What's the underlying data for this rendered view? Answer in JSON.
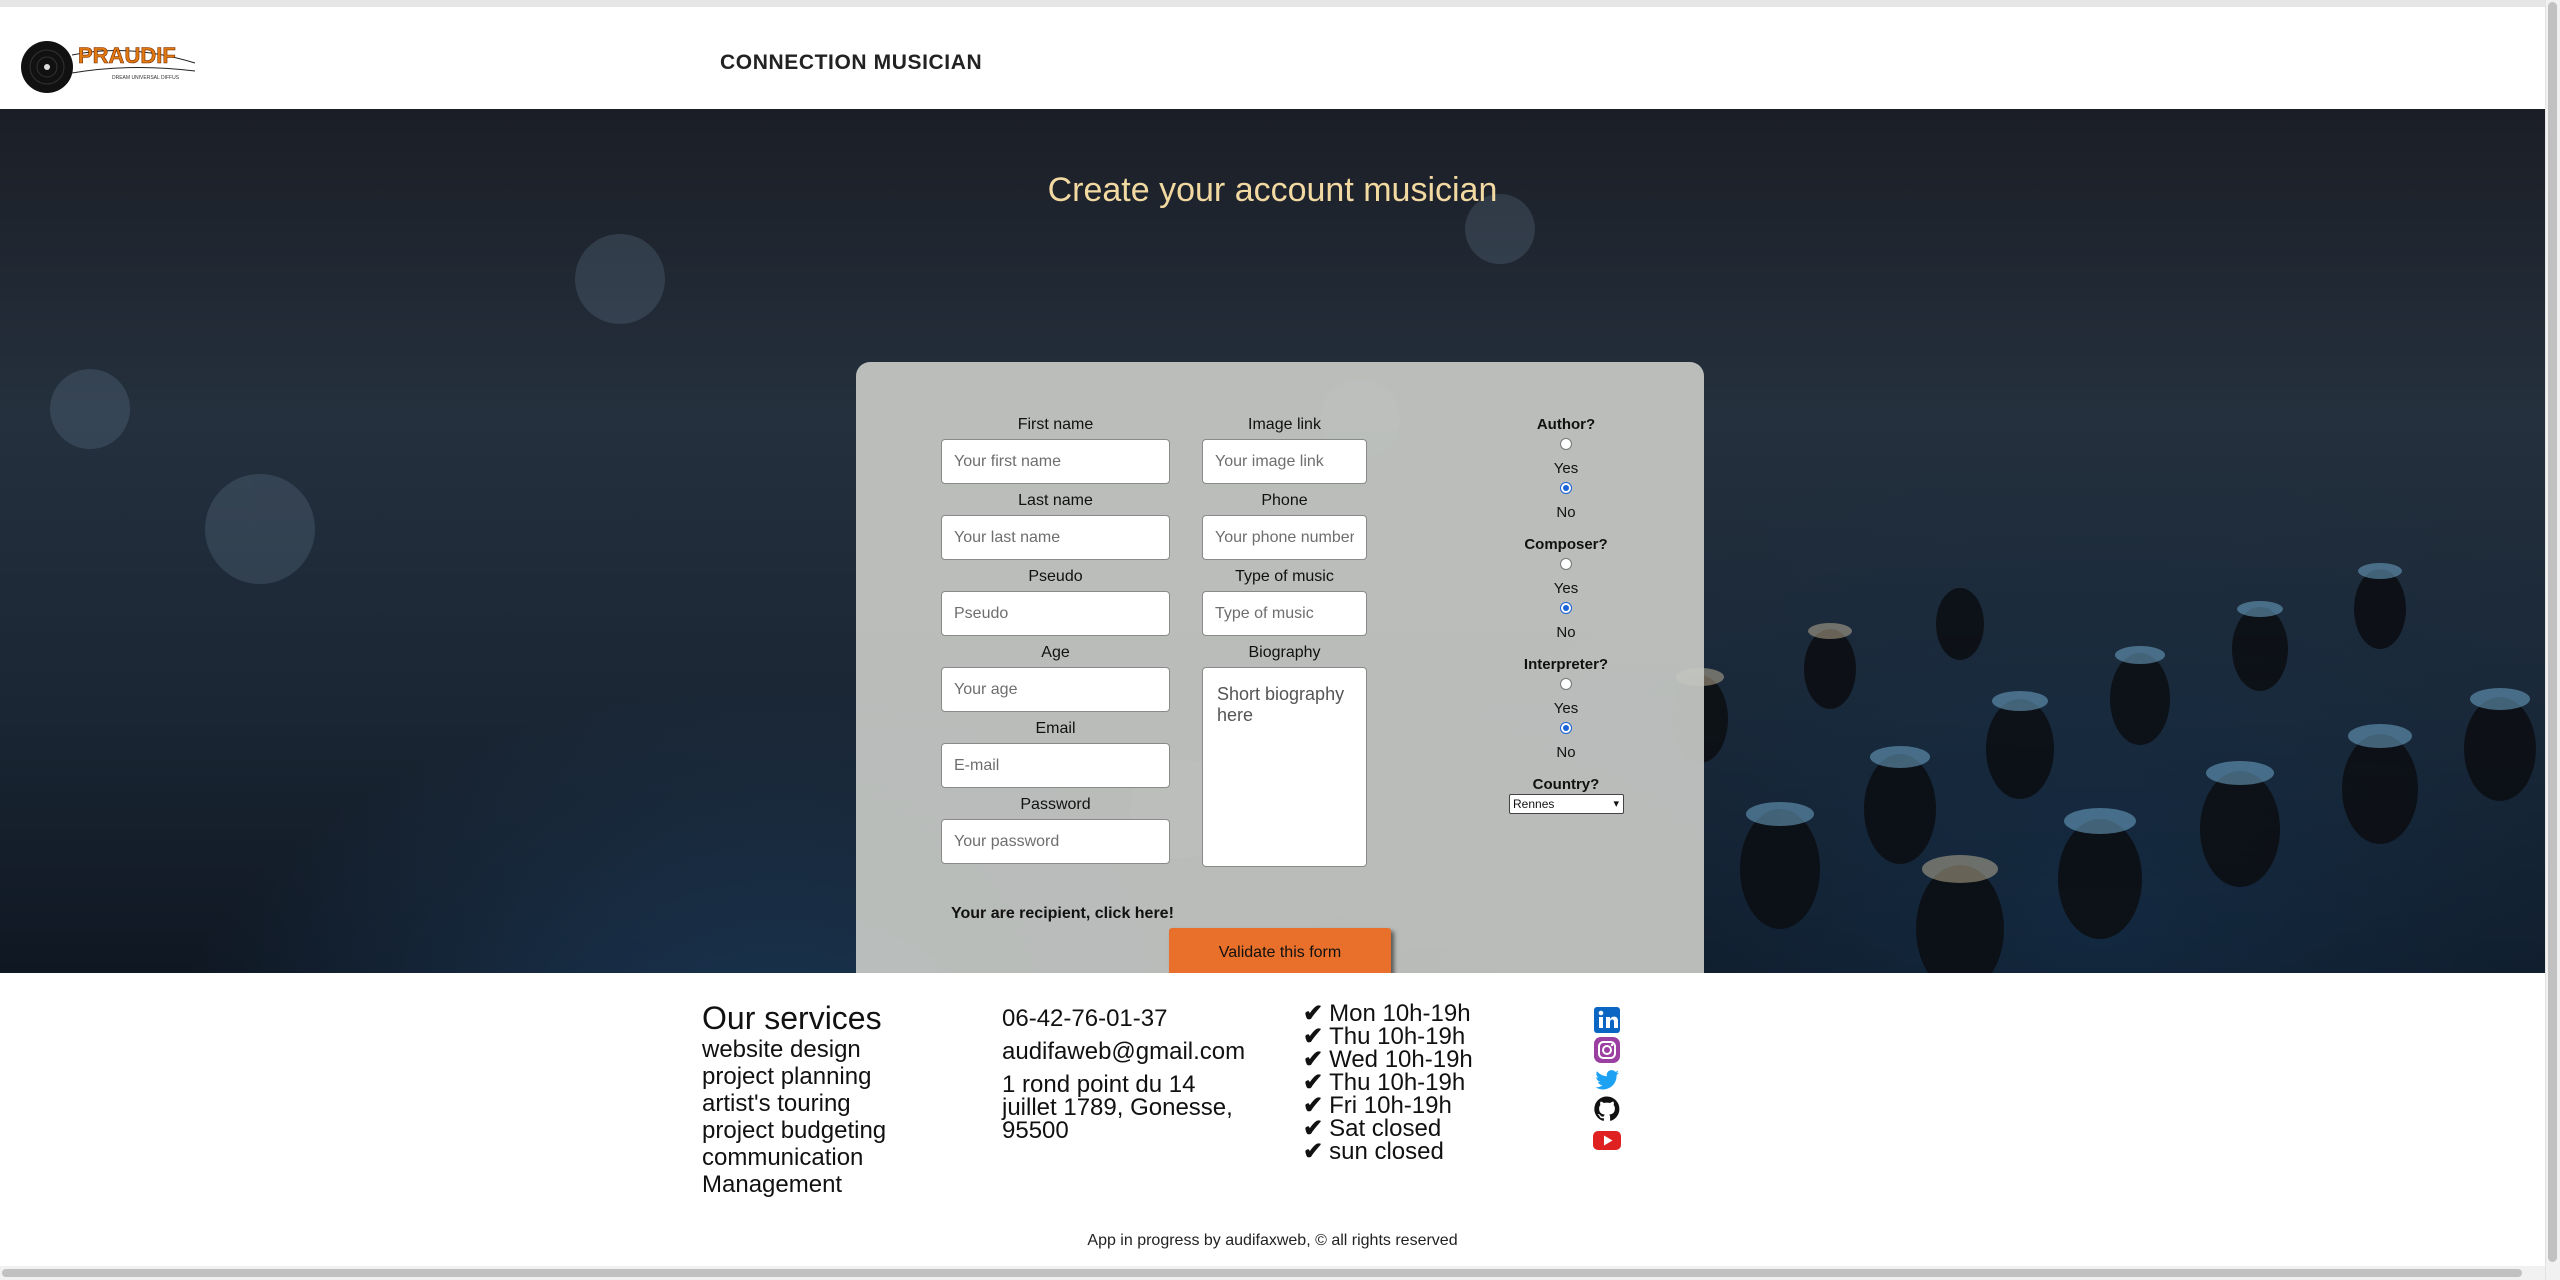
{
  "header": {
    "logo_text": "PRAUDIF",
    "logo_tagline": "DREAM UNIVERSAL DIFFUS",
    "brand_link": "CONNECTION MUSICIAN"
  },
  "hero": {
    "title": "Create your account musician"
  },
  "form": {
    "left_fields": [
      {
        "label": "First name",
        "placeholder": "Your first name"
      },
      {
        "label": "Last name",
        "placeholder": "Your last name"
      },
      {
        "label": "Pseudo",
        "placeholder": "Pseudo"
      },
      {
        "label": "Age",
        "placeholder": "Your age"
      },
      {
        "label": "Email",
        "placeholder": "E-mail"
      },
      {
        "label": "Password",
        "placeholder": "Your password"
      }
    ],
    "mid_fields": [
      {
        "label": "Image link",
        "placeholder": "Your image link"
      },
      {
        "label": "Phone",
        "placeholder": "Your phone number"
      },
      {
        "label": "Type of music",
        "placeholder": "Type of music"
      },
      {
        "label": "Biography",
        "placeholder": "Short biography here"
      }
    ],
    "questions": [
      {
        "label": "Author?",
        "yes": "Yes",
        "no": "No",
        "selected": "No"
      },
      {
        "label": "Composer?",
        "yes": "Yes",
        "no": "No",
        "selected": "No"
      },
      {
        "label": "Interpreter?",
        "yes": "Yes",
        "no": "No",
        "selected": "No"
      }
    ],
    "country": {
      "label": "Country?",
      "selected": "Rennes"
    },
    "recipient_link": "Your are recipient, click here!",
    "submit_label": "Validate this form"
  },
  "footer": {
    "services_title": "Our services",
    "services": [
      "website design",
      "project planning",
      "artist's touring",
      "project budgeting",
      "communication",
      "Management"
    ],
    "phone": "06-42-76-01-37",
    "email": "audifaweb@gmail.com",
    "address": "1 rond point du 14 juillet 1789, Gonesse, 95500",
    "hours": [
      "Mon 10h-19h",
      "Thu 10h-19h",
      "Wed 10h-19h",
      "Thu 10h-19h",
      "Fri 10h-19h",
      "Sat closed",
      "sun closed"
    ],
    "social": [
      "linkedin-icon",
      "instagram-icon",
      "twitter-icon",
      "github-icon",
      "youtube-icon"
    ],
    "copyright": "App in progress by audifaxweb, © all rights reserved"
  },
  "colors": {
    "accent_button": "#e8702a",
    "hero_title": "#f2d9a1",
    "card_bg": "#c6c8c4"
  }
}
